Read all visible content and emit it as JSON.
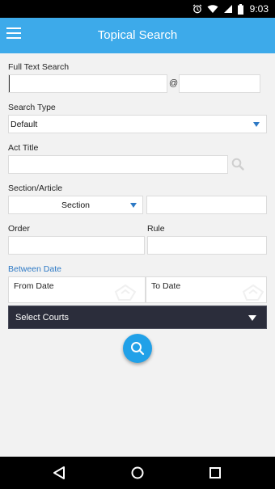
{
  "status_bar": {
    "time": "9:03"
  },
  "app_bar": {
    "title": "Topical Search"
  },
  "form": {
    "full_text_search": {
      "label": "Full Text Search",
      "value": "",
      "value2": "",
      "separator": "@"
    },
    "search_type": {
      "label": "Search Type",
      "selected": "Default"
    },
    "act_title": {
      "label": "Act Title",
      "value": ""
    },
    "section_article": {
      "label": "Section/Article",
      "selected": "Section",
      "value": ""
    },
    "order": {
      "label": "Order",
      "value": ""
    },
    "rule": {
      "label": "Rule",
      "value": ""
    },
    "between_date": {
      "label": "Between Date",
      "from_label": "From Date",
      "to_label": "To Date"
    },
    "courts": {
      "selected": "Select Courts"
    }
  },
  "colors": {
    "app_bar": "#3daaea",
    "accent": "#2d79c5",
    "courts_bg": "#2b2d3b",
    "fab": "#21a1e8"
  },
  "icons": [
    "alarm-icon",
    "wifi-icon",
    "signal-icon",
    "battery-icon",
    "menu-icon",
    "search-icon",
    "back-icon",
    "home-icon",
    "recents-icon"
  ]
}
